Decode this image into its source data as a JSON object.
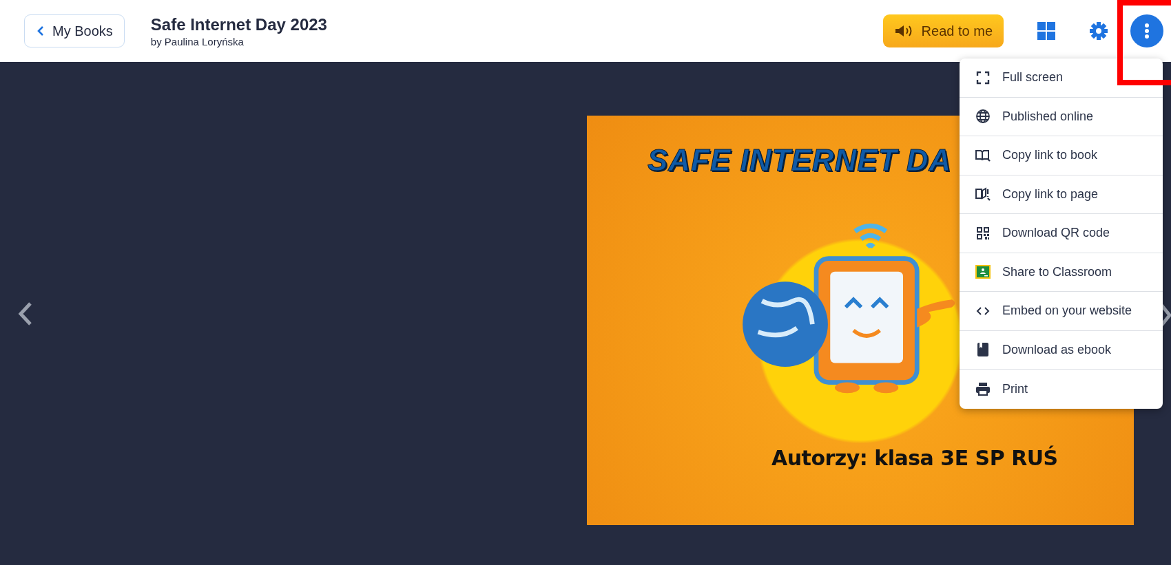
{
  "header": {
    "back_button": {
      "label": "My Books"
    },
    "title": "Safe Internet Day 2023",
    "author": "by Paulina Loryńska",
    "read_button": {
      "label": "Read to me"
    }
  },
  "menu": {
    "items": [
      {
        "kind": "fullscreen",
        "label": "Full screen"
      },
      {
        "kind": "globe",
        "label": "Published online"
      },
      {
        "kind": "book-link",
        "label": "Copy link to book"
      },
      {
        "kind": "page-link",
        "label": "Copy link to page"
      },
      {
        "kind": "qr",
        "label": "Download QR code"
      },
      {
        "kind": "classroom",
        "label": "Share to Classroom"
      },
      {
        "kind": "embed",
        "label": "Embed on your website"
      },
      {
        "kind": "ebook",
        "label": "Download as ebook"
      },
      {
        "kind": "print",
        "label": "Print"
      }
    ]
  },
  "book": {
    "cover_title": "SAFE INTERNET DA",
    "cover_authors": "Autorzy: klasa 3E SP RUŚ"
  }
}
